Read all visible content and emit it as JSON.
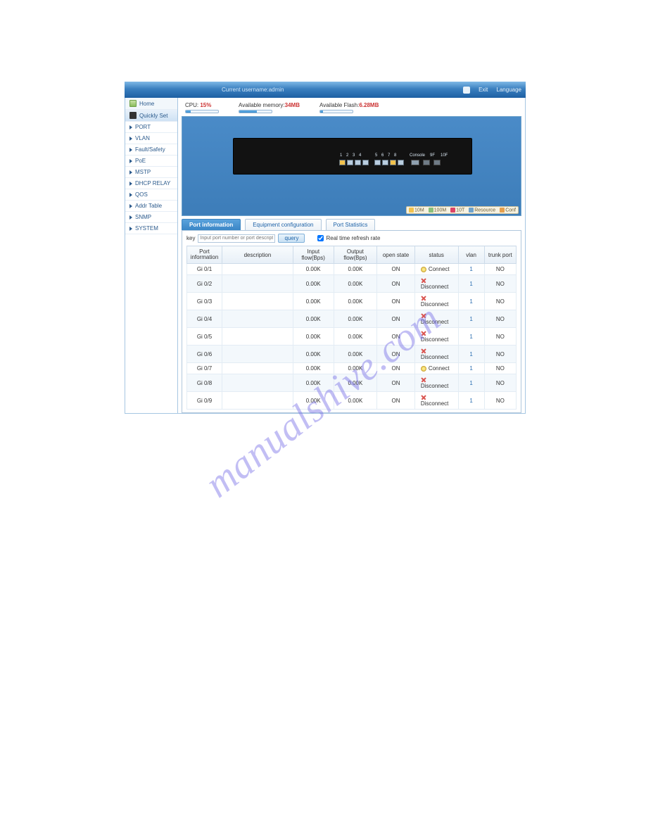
{
  "topbar": {
    "user_label": "Current username:admin",
    "exit": "Exit",
    "language": "Language"
  },
  "sidebar": {
    "home": "Home",
    "quickly": "Quickly Set",
    "items": [
      "PORT",
      "VLAN",
      "Fault/Safety",
      "PoE",
      "MSTP",
      "DHCP RELAY",
      "QOS",
      "Addr Table",
      "SNMP",
      "SYSTEM"
    ]
  },
  "stats": {
    "cpu_label": "CPU:",
    "cpu_val": "15%",
    "cpu_fill_pct": 15,
    "mem_label": "Available memory:",
    "mem_val": "34MB",
    "mem_fill_pct": 55,
    "flash_label": "Available Flash:",
    "flash_val": "6.28MB",
    "flash_fill_pct": 8
  },
  "ports": {
    "row1_labels": "1  2  3  4",
    "row2_labels": "5  6  7  8",
    "console": "Console",
    "p9": "9F",
    "p10": "10F"
  },
  "legend": {
    "a": "10M",
    "b": "100M",
    "c": "10T",
    "d": "Resource",
    "e": "Conf"
  },
  "tabs": {
    "t1": "Port information",
    "t2": "Equipment configuration",
    "t3": "Port Statistics"
  },
  "keyrow": {
    "label": "key",
    "placeholder": "Input port number or port descriptio",
    "btn": "query",
    "chk": "Real time refresh rate"
  },
  "thead": {
    "c1": "Port information",
    "c2": "description",
    "c3": "Input flow(Bps)",
    "c4": "Output flow(Bps)",
    "c5": "open state",
    "c6": "status",
    "c7": "vlan",
    "c8": "trunk port"
  },
  "rows": [
    {
      "port": "Gi 0/1",
      "desc": "",
      "in": "0.00K",
      "out": "0.00K",
      "open": "ON",
      "status": "Connect",
      "stype": "c",
      "vlan": "1",
      "trunk": "NO"
    },
    {
      "port": "Gi 0/2",
      "desc": "",
      "in": "0.00K",
      "out": "0.00K",
      "open": "ON",
      "status": "Disconnect",
      "stype": "d",
      "vlan": "1",
      "trunk": "NO"
    },
    {
      "port": "Gi 0/3",
      "desc": "",
      "in": "0.00K",
      "out": "0.00K",
      "open": "ON",
      "status": "Disconnect",
      "stype": "d",
      "vlan": "1",
      "trunk": "NO"
    },
    {
      "port": "Gi 0/4",
      "desc": "",
      "in": "0.00K",
      "out": "0.00K",
      "open": "ON",
      "status": "Disconnect",
      "stype": "d",
      "vlan": "1",
      "trunk": "NO"
    },
    {
      "port": "Gi 0/5",
      "desc": "",
      "in": "0.00K",
      "out": "0.00K",
      "open": "ON",
      "status": "Disconnect",
      "stype": "d",
      "vlan": "1",
      "trunk": "NO"
    },
    {
      "port": "Gi 0/6",
      "desc": "",
      "in": "0.00K",
      "out": "0.00K",
      "open": "ON",
      "status": "Disconnect",
      "stype": "d",
      "vlan": "1",
      "trunk": "NO"
    },
    {
      "port": "Gi 0/7",
      "desc": "",
      "in": "0.00K",
      "out": "0.00K",
      "open": "ON",
      "status": "Connect",
      "stype": "c",
      "vlan": "1",
      "trunk": "NO"
    },
    {
      "port": "Gi 0/8",
      "desc": "",
      "in": "0.00K",
      "out": "0.00K",
      "open": "ON",
      "status": "Disconnect",
      "stype": "d",
      "vlan": "1",
      "trunk": "NO"
    },
    {
      "port": "Gi 0/9",
      "desc": "",
      "in": "0.00K",
      "out": "0.00K",
      "open": "ON",
      "status": "Disconnect",
      "stype": "d",
      "vlan": "1",
      "trunk": "NO"
    }
  ],
  "watermark": "manualshive.com"
}
